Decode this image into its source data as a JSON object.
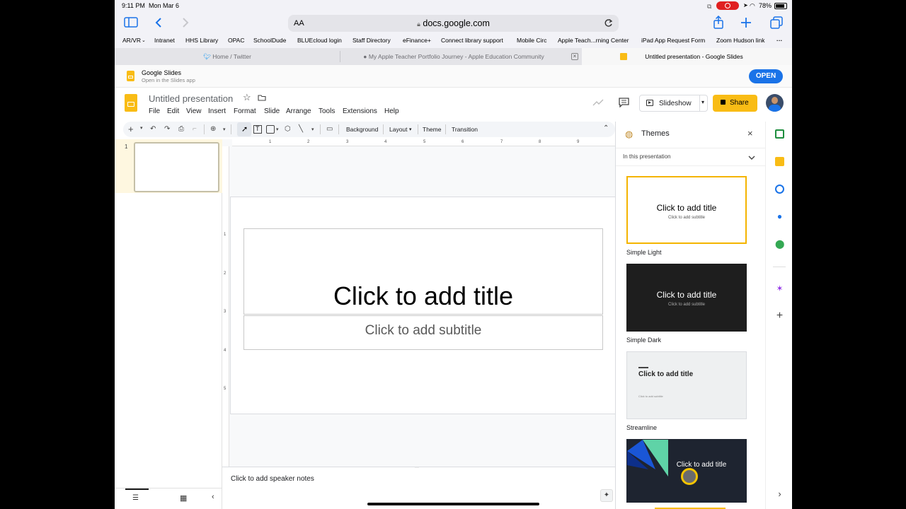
{
  "status": {
    "time": "9:11 PM",
    "date": "Mon Mar 6",
    "battery": "78%"
  },
  "safari": {
    "aa": "AA",
    "url": "docs.google.com",
    "bookmarks": [
      "AR/VR",
      "Intranet",
      "HHS Library",
      "OPAC",
      "SchoolDude",
      "BLUEcloud login",
      "Staff Directory",
      "eFinance+",
      "Connect library support",
      "Mobile Circ",
      "Apple Teach...rning Center",
      "iPad App Request Form",
      "Zoom Hudson link"
    ],
    "tabs": [
      "Home / Twitter",
      "My Apple Teacher Portfolio Journey - Apple Education Community",
      "Untitled presentation - Google Slides"
    ]
  },
  "banner": {
    "app_name": "Google Slides",
    "subtitle": "Open in the Slides app",
    "open_label": "OPEN"
  },
  "doc": {
    "title": "Untitled presentation",
    "menu": [
      "File",
      "Edit",
      "View",
      "Insert",
      "Format",
      "Slide",
      "Arrange",
      "Tools",
      "Extensions",
      "Help"
    ],
    "slideshow_label": "Slideshow",
    "share_label": "Share"
  },
  "toolbar": {
    "background": "Background",
    "layout": "Layout",
    "theme": "Theme",
    "transition": "Transition"
  },
  "ruler": {
    "h_ticks": [
      "1",
      "2",
      "3",
      "4",
      "5",
      "6",
      "7",
      "8",
      "9"
    ],
    "v_ticks": [
      "1",
      "2",
      "3",
      "4",
      "5"
    ]
  },
  "filmstrip": {
    "slide_number": "1"
  },
  "slide": {
    "title_placeholder": "Click to add title",
    "subtitle_placeholder": "Click to add subtitle"
  },
  "notes": {
    "placeholder": "Click to add speaker notes"
  },
  "themes_panel": {
    "title": "Themes",
    "section": "In this presentation",
    "themes": [
      {
        "name": "Simple Light",
        "title": "Click to add title",
        "subtitle": "Click to add subtitle"
      },
      {
        "name": "Simple Dark",
        "title": "Click to add title",
        "subtitle": "Click to add subtitle"
      },
      {
        "name": "Streamline",
        "title": "Click to add title",
        "subtitle": "Click to add subtitle"
      },
      {
        "name": "",
        "title": "Click to add title",
        "subtitle": ""
      }
    ]
  },
  "colors": {
    "accent_yellow": "#f9bc15",
    "open_blue": "#1a73e8",
    "selection_border": "#f4b400"
  }
}
